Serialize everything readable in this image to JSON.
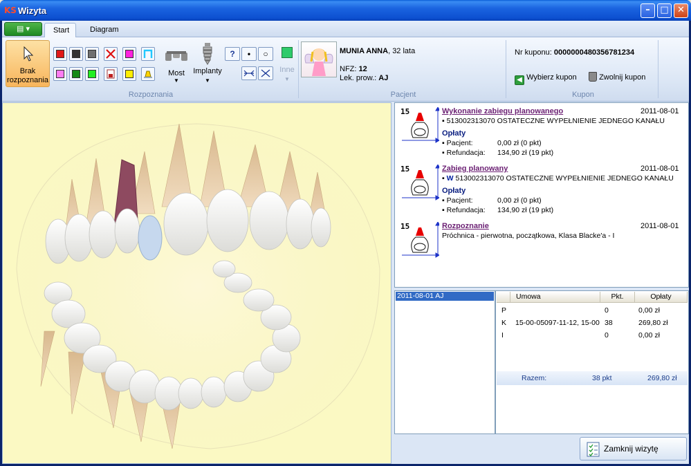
{
  "window": {
    "title": "Wizyta",
    "app_logo": "KS"
  },
  "ribbon": {
    "tabs": [
      "Start",
      "Diagram"
    ],
    "app_menu_glyph": "▤ ▾",
    "groups": {
      "diagnoses": "Rozpoznania",
      "patient": "Pacjent",
      "coupon": "Kupon"
    },
    "no_diagnosis_label": "Brak rozpoznania",
    "bridge_label": "Most",
    "implants_label": "Implanty",
    "other_label": "Inne",
    "swatch_colors_row1": [
      "#e11818",
      "#333333",
      "#707070",
      "red-x",
      "#ff22dd",
      "#22c8ff-outline"
    ],
    "swatch_colors_row2": [
      "#ff7cf2",
      "#168a16",
      "#22ee22",
      "#a03030-doc",
      "#ffee00",
      "#ffd400-bell"
    ],
    "symbols": {
      "question": "?",
      "dot": "•",
      "circle": "○"
    }
  },
  "patient": {
    "name": "MUNIA ANNA",
    "age": ", 32 lata",
    "nfz_label": "NFZ:",
    "nfz_value": "12",
    "doctor_label": "Lek. prow.:",
    "doctor_value": "AJ"
  },
  "coupon": {
    "number_label": "Nr kuponu:",
    "number_value": "0000000480356781234",
    "select_label": "Wybierz kupon",
    "release_label": "Zwolnij kupon"
  },
  "history": [
    {
      "tooth": "15",
      "title": "Wykonanie zabiegu planowanego",
      "date": "2011-08-01",
      "line": "▪ 513002313070 OSTATECZNE WYPEŁNIENIE JEDNEGO KANAŁU",
      "fees_label": "Opłaty",
      "patient_label": "▪ Pacjent:",
      "patient_value": "0,00 zł (0 pkt)",
      "refund_label": "▪ Refundacja:",
      "refund_value": "134,90 zł (19 pkt)"
    },
    {
      "tooth": "15",
      "title": "Zabieg planowany",
      "date": "2011-08-01",
      "marker": "W",
      "line": " 513002313070 OSTATECZNE WYPEŁNIENIE JEDNEGO KANAŁU",
      "fees_label": "Opłaty",
      "patient_label": "▪ Pacjent:",
      "patient_value": "0,00 zł (0 pkt)",
      "refund_label": "▪ Refundacja:",
      "refund_value": "134,90 zł (19 pkt)"
    },
    {
      "tooth": "15",
      "title": "Rozpoznanie",
      "date": "2011-08-01",
      "line": "Próchnica - pierwotna, początkowa, Klasa Blacke'a - I"
    }
  ],
  "visits": [
    "2011-08-01 AJ"
  ],
  "contracts": {
    "headers": [
      "Umowa",
      "Pkt.",
      "Opłaty"
    ],
    "rows": [
      {
        "code": "P",
        "contract": "",
        "points": "0",
        "fee": "0,00 zł"
      },
      {
        "code": "K",
        "contract": "15-00-05097-11-12, 15-00",
        "points": "38",
        "fee": "269,80 zł"
      },
      {
        "code": "I",
        "contract": "",
        "points": "0",
        "fee": "0,00 zł"
      }
    ],
    "total_label": "Razem:",
    "total_points": "38 pkt",
    "total_fee": "269,80 zł"
  },
  "footer": {
    "close_visit_label": "Zamknij wizytę"
  }
}
